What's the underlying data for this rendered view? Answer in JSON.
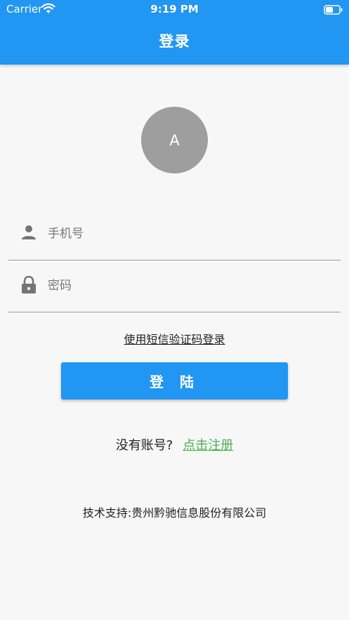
{
  "status_bar": {
    "carrier": "Carrier",
    "time": "9:19 PM"
  },
  "header": {
    "title": "登录"
  },
  "avatar": {
    "initial": "A"
  },
  "form": {
    "phone": {
      "placeholder": "手机号",
      "value": "",
      "icon": "person-icon"
    },
    "password": {
      "placeholder": "密码",
      "value": "",
      "icon": "lock-icon"
    }
  },
  "sms_login_link": "使用短信验证码登录",
  "login_button": "登 陆",
  "register": {
    "prompt": "没有账号?",
    "link": "点击注册"
  },
  "footer": {
    "support": "技术支持:贵州黔驰信息股份有限公司"
  },
  "colors": {
    "primary": "#2196f3",
    "link_green": "#4caf50",
    "avatar_grey": "#9e9e9e"
  }
}
